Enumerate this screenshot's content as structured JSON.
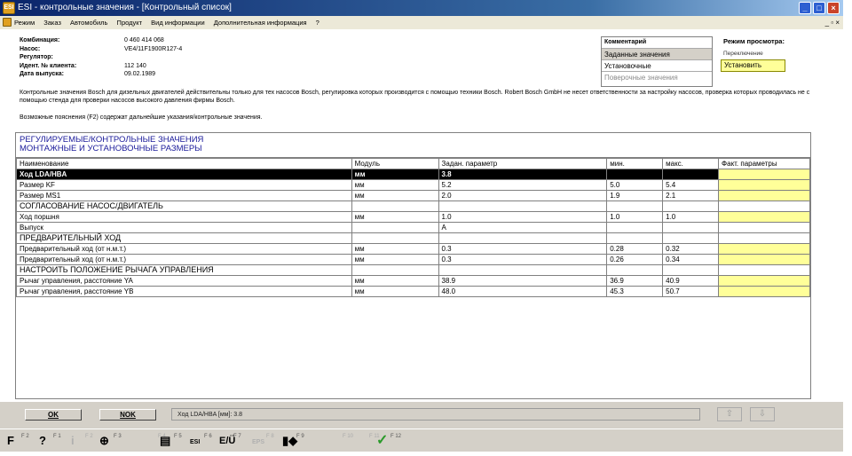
{
  "window": {
    "title": "ESI - контрольные значения - [Контрольный список]",
    "icon": "esi-app-icon",
    "controls": {
      "minimize": "_",
      "maximize": "□",
      "close": "×"
    }
  },
  "menu": {
    "items": [
      "Режим",
      "Заказ",
      "Автомобиль",
      "Продукт",
      "Вид информации",
      "Дополнительная информация",
      "?"
    ],
    "mdi_controls": "_ ▫ ×"
  },
  "info": {
    "rows": [
      {
        "key": "Комбинация:",
        "value": "0 460 414 068"
      },
      {
        "key": "Насос:",
        "value": "VE4/11F1900R127-4"
      },
      {
        "key": "Регулятор:",
        "value": ""
      },
      {
        "key": "Идент. № клиента:",
        "value": "112 140"
      },
      {
        "key": "Дата выпуска:",
        "value": "09.02.1989"
      }
    ]
  },
  "comment": {
    "title": "Комментарий",
    "items": [
      "Заданные значения",
      "Установочные",
      "Поверочные значения"
    ]
  },
  "view_mode": {
    "title": "Режим просмотра:",
    "sub": "Переключение",
    "button": "Установить"
  },
  "notes": {
    "disclaimer": "Контрольные значения Bosch для дизельных двигателей действительны только для тех насосов Bosch, регулировка которых производится с помощью техники Bosch. Robert Bosch GmbH не несет ответственности за настройку насосов, проверка которых проводилась не с помощью стенда для проверки насосов высокого давления фирмы Bosch.",
    "hint": "Возможные пояснения (F2) содержат дальнейшие указания/контрольные значения."
  },
  "table": {
    "header_line1": "РЕГУЛИРУЕМЫЕ/КОНТРОЛЬНЫЕ ЗНАЧЕНИЯ",
    "header_line2": "МОНТАЖНЫЕ И УСТАНОВОЧНЫЕ РАЗМЕРЫ",
    "columns": [
      "Наименование",
      "Модуль",
      "Задан. параметр",
      "мин.",
      "макс.",
      "Факт. параметры"
    ],
    "rows": [
      {
        "name": "Ход LDA/HBA",
        "unit": "мм",
        "target": "3.8",
        "min": "",
        "max": "",
        "fact": "",
        "selected": true
      },
      {
        "name": "Размер KF",
        "unit": "мм",
        "target": "5.2",
        "min": "5.0",
        "max": "5.4",
        "fact": ""
      },
      {
        "name": "Размер MS1",
        "unit": "мм",
        "target": "2.0",
        "min": "1.9",
        "max": "2.1",
        "fact": ""
      },
      {
        "name": "СОГЛАСОВАНИЕ НАСОС/ДВИГАТЕЛЬ",
        "section": true
      },
      {
        "name": "Ход поршня",
        "unit": "мм",
        "target": "1.0",
        "min": "1.0",
        "max": "1.0",
        "fact": ""
      },
      {
        "name": "Выпуск",
        "unit": "",
        "target": "A",
        "min": "",
        "max": "",
        "fact": "",
        "nofact": true
      },
      {
        "name": "ПРЕДВАРИТЕЛЬНЫЙ ХОД",
        "section": true
      },
      {
        "name": "Предварительный ход (от н.м.т.)",
        "unit": "мм",
        "target": "0.3",
        "min": "0.28",
        "max": "0.32",
        "fact": ""
      },
      {
        "name": "Предварительный ход (от н.м.т.)",
        "unit": "мм",
        "target": "0.3",
        "min": "0.26",
        "max": "0.34",
        "fact": ""
      },
      {
        "name": "НАСТРОИТЬ ПОЛОЖЕНИЕ РЫЧАГА УПРАВЛЕНИЯ",
        "section": true
      },
      {
        "name": "Рычаг управления, расстояние YA",
        "unit": "мм",
        "target": "38.9",
        "min": "36.9",
        "max": "40.9",
        "fact": ""
      },
      {
        "name": "Рычаг управления, расстояние YB",
        "unit": "мм",
        "target": "48.0",
        "min": "45.3",
        "max": "50.7",
        "fact": ""
      }
    ]
  },
  "bottom": {
    "ok": "OK",
    "nok": "NOK",
    "status": "Ход LDA/HBA  [мм]: 3.8",
    "up": "⇧",
    "down": "⇩"
  },
  "toolbar": {
    "keys": [
      {
        "name": "f-key-f2",
        "icon": "F",
        "label": "F 2",
        "disabled": false
      },
      {
        "name": "help-icon",
        "icon": "?",
        "label": "F 1",
        "disabled": false
      },
      {
        "name": "info-icon",
        "icon": "i",
        "label": "F 2",
        "disabled": true
      },
      {
        "name": "globe-icon",
        "icon": "⊕",
        "label": "F 3",
        "disabled": false
      },
      {
        "name": "f4-key",
        "icon": "",
        "label": "F 4",
        "disabled": true
      },
      {
        "name": "printer-icon",
        "icon": "▤",
        "label": "F 5",
        "disabled": false
      },
      {
        "name": "esi-sheet-icon",
        "icon": "ESI",
        "label": "F 6",
        "disabled": false
      },
      {
        "name": "eu-icon",
        "icon": "E/Ü",
        "label": "F 7",
        "disabled": false
      },
      {
        "name": "eps-icon",
        "icon": "EPS",
        "label": "F 8",
        "disabled": true
      },
      {
        "name": "pump-icon",
        "icon": "▮◆",
        "label": "F 9",
        "disabled": false
      },
      {
        "name": "f10-key",
        "icon": "",
        "label": "F 10",
        "disabled": true
      },
      {
        "name": "f11-key",
        "icon": "",
        "label": "F 11",
        "disabled": true
      },
      {
        "name": "checkmark-icon",
        "icon": "✓",
        "label": "F 12",
        "disabled": false
      }
    ]
  },
  "colors": {
    "title_bar": "#0a246a",
    "selected_row": "#000000",
    "fact_cell": "#ffff99",
    "section_header_text": "#1a1a9a",
    "checkmark": "#2a9a2a"
  }
}
